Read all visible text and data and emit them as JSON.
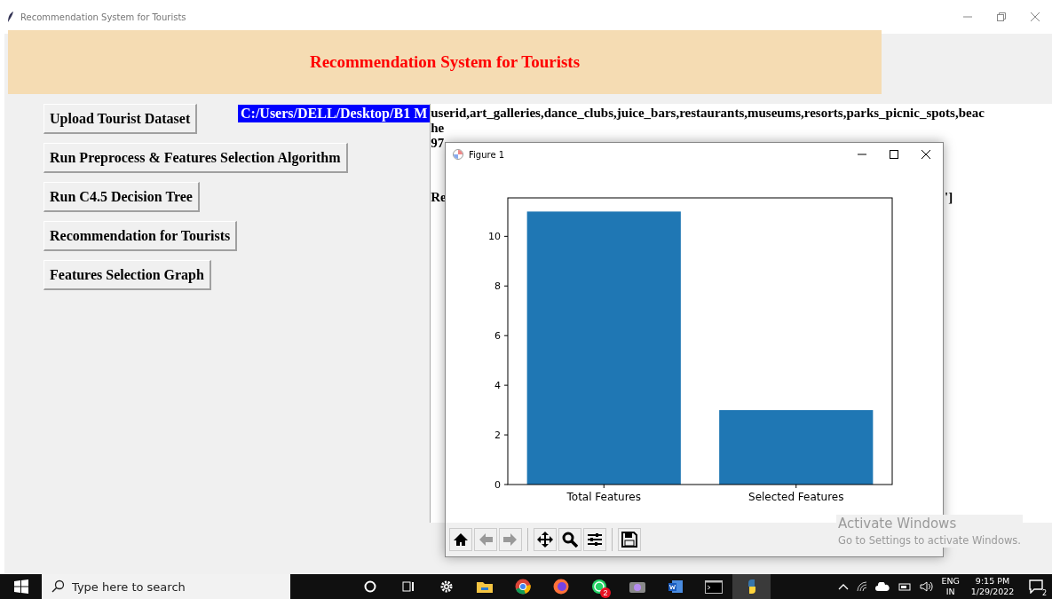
{
  "window": {
    "title": "Recommendation System for Tourists"
  },
  "header": {
    "title": "Recommendation System for Tourists"
  },
  "buttons": [
    "Upload Tourist Dataset",
    "Run Preprocess & Features Selection Algorithm",
    "Run C4.5 Decision Tree",
    "Recommendation for Tourists",
    "Features Selection Graph"
  ],
  "path_label": "C:/Users/DELL/Desktop/B1 M",
  "output_lines": [
    "userid,art_galleries,dance_clubs,juice_bars,restaurants,museums,resorts,parks_picnic_spots,beac",
    "he",
    "97"
  ],
  "result_line": {
    "left": "Re",
    "right": "']"
  },
  "figure": {
    "title": "Figure 1",
    "chart_data": {
      "type": "bar",
      "categories": [
        "Total Features",
        "Selected Features"
      ],
      "values": [
        11,
        3
      ],
      "ylim": [
        0,
        11.55
      ],
      "yticks": [
        0,
        2,
        4,
        6,
        8,
        10
      ]
    },
    "toolbar": [
      {
        "kind": "home"
      },
      {
        "kind": "back"
      },
      {
        "kind": "forward"
      },
      {
        "kind": "sep"
      },
      {
        "kind": "pan"
      },
      {
        "kind": "zoom"
      },
      {
        "kind": "configure"
      },
      {
        "kind": "sep"
      },
      {
        "kind": "save"
      }
    ]
  },
  "activation": {
    "title": "Activate Windows",
    "subtitle": "Go to Settings to activate Windows."
  },
  "taskbar": {
    "search_placeholder": "Type here to search",
    "apps": [
      {
        "kind": "cortana"
      },
      {
        "kind": "taskview"
      },
      {
        "kind": "settings"
      },
      {
        "kind": "explorer"
      },
      {
        "kind": "chrome"
      },
      {
        "kind": "firefox"
      },
      {
        "kind": "whatsapp",
        "badge": "2"
      },
      {
        "kind": "camera"
      },
      {
        "kind": "word"
      },
      {
        "kind": "terminal"
      },
      {
        "kind": "python"
      }
    ],
    "language": "ENG",
    "region": "IN",
    "time": "9:15 PM",
    "date": "1/29/2022",
    "notifications": "2"
  }
}
